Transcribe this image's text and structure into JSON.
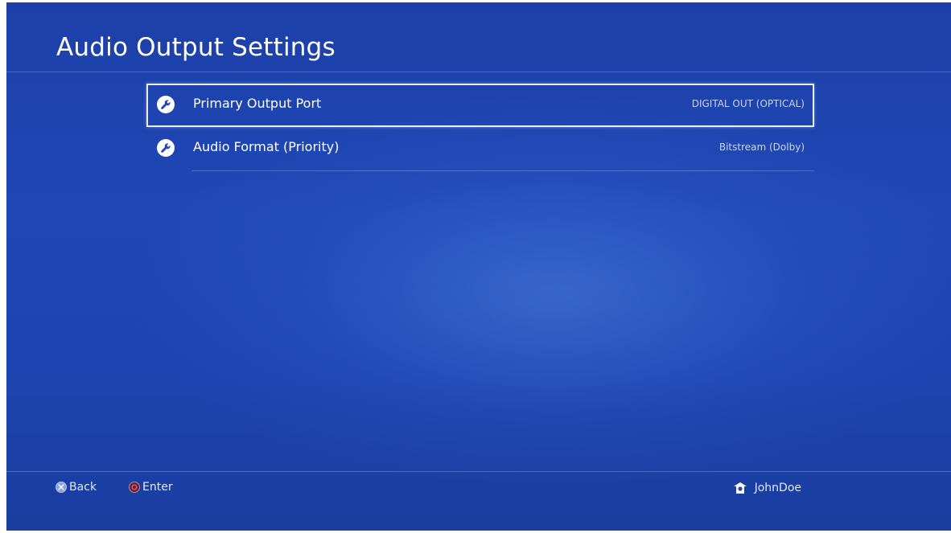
{
  "header": {
    "title": "Audio Output Settings"
  },
  "menu": {
    "items": [
      {
        "label": "Primary Output Port",
        "value": "DIGITAL OUT (OPTICAL)",
        "icon": "wrench-icon",
        "selected": true
      },
      {
        "label": "Audio Format (Priority)",
        "value": "Bitstream (Dolby)",
        "icon": "wrench-icon",
        "selected": false
      }
    ]
  },
  "footer": {
    "back_label": "Back",
    "enter_label": "Enter",
    "username": "JohnDoe",
    "back_icon": "cross-button-icon",
    "enter_icon": "circle-button-icon",
    "user_icon": "user-avatar-icon"
  },
  "colors": {
    "background": "#1f48b6",
    "text": "#ffffff",
    "value_text": "#c7d6f7",
    "selection_border": "#e8eefc"
  }
}
